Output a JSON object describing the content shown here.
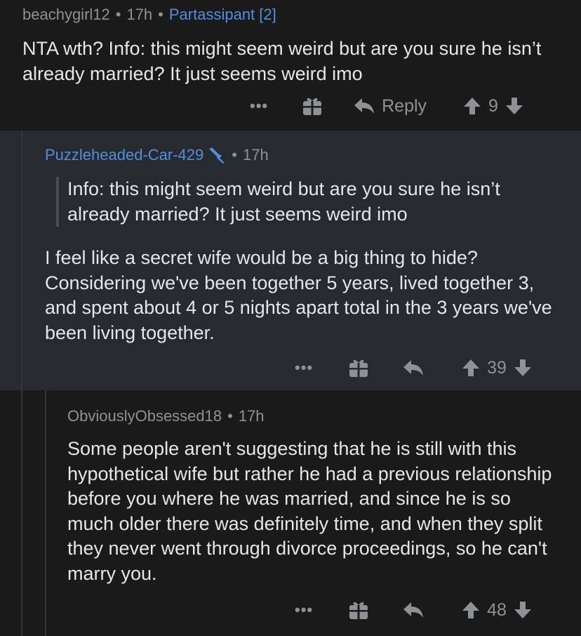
{
  "comments": [
    {
      "author": "beachygirl12",
      "time": "17h",
      "flair": "Partassipant [2]",
      "body": "NTA wth? Info: this might seem weird but are you sure he isn’t already married? It just seems weird imo",
      "actions": {
        "more": "•••",
        "reply_label": "Reply",
        "score": "9"
      }
    },
    {
      "author": "Puzzleheaded-Car-429",
      "time": "17h",
      "quote": "Info: this might seem weird but are you sure he isn’t already married? It just seems weird imo",
      "body": "I feel like a secret wife would be a big thing to hide? Considering we've been together 5 years, lived together 3, and spent about 4 or 5 nights apart total in the 3 years we've been living together.",
      "actions": {
        "more": "•••",
        "score": "39"
      }
    },
    {
      "author": "ObviouslyObsessed18",
      "time": "17h",
      "body": "Some people aren't suggesting that he is still with this hypothetical wife but rather he had a previous relationship before you where he was married, and since he is so much older there was definitely time, and when they split they never went through divorce proceedings, so he can't marry you.",
      "actions": {
        "more": "•••",
        "score": "48"
      }
    }
  ],
  "colors": {
    "background": "#1a1a1b",
    "highlight_background": "#272a2f",
    "accent_blue": "#4f8fe0",
    "muted_text": "#8e9196",
    "body_text": "#e4e6e8"
  },
  "icons": {
    "dot": "•",
    "gift": "gift-icon",
    "reply": "reply-arrow-icon",
    "upvote": "upvote-arrow-icon",
    "downvote": "downvote-arrow-icon",
    "mod": "mod-sword-icon"
  }
}
